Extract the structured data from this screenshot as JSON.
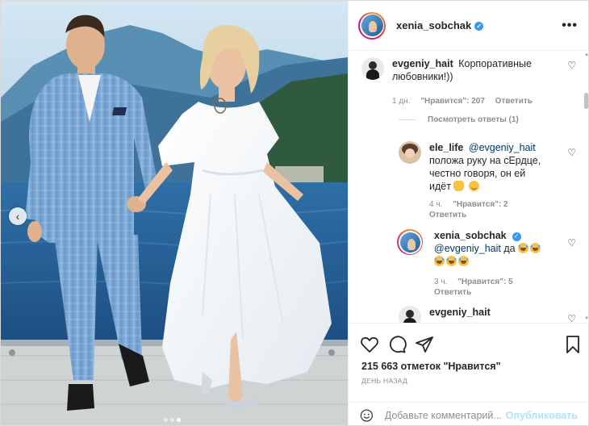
{
  "post": {
    "author": "xenia_sobchak",
    "carousel_dots": 3,
    "carousel_active": 2
  },
  "comments": [
    {
      "user": "evgeniy_hait",
      "text_line1": "Корпоративные",
      "text_line2": "любовники!))",
      "time": "1 дн.",
      "likes": "\"Нравится\": 207",
      "reply": "Ответить",
      "avatar": "evgeniy-avatar"
    }
  ],
  "view_replies": "Посмотреть ответы (1)",
  "replies": [
    {
      "user": "ele_life",
      "mention": "@evgeniy_hait",
      "line2": "положа руку на сЕрдце,",
      "line3": "честно говоря, он ей",
      "line4": "идёт",
      "emoji": [
        "ok-hand",
        "smile"
      ],
      "time": "4 ч.",
      "likes": "\"Нравится\": 2",
      "reply": "Ответить"
    },
    {
      "user": "xenia_sobchak",
      "mention": "@evgeniy_hait",
      "text": "да",
      "emoji": [
        "laughing",
        "laughing",
        "laughing",
        "laughing",
        "laughing"
      ],
      "time": "3 ч.",
      "likes": "\"Нравится\": 5",
      "reply": "Ответить"
    },
    {
      "user": "evgeniy_hait"
    }
  ],
  "actions": {
    "likes_count": "215 663 отметок \"Нравится\"",
    "date": "ДЕНЬ НАЗАД",
    "comment_placeholder": "Добавьте комментарий...",
    "publish": "Опубликовать"
  },
  "colors": {
    "verified": "#3897f0",
    "mention": "#00376b",
    "publish_disabled": "#b2dffc",
    "meta": "#8e8e8e"
  }
}
